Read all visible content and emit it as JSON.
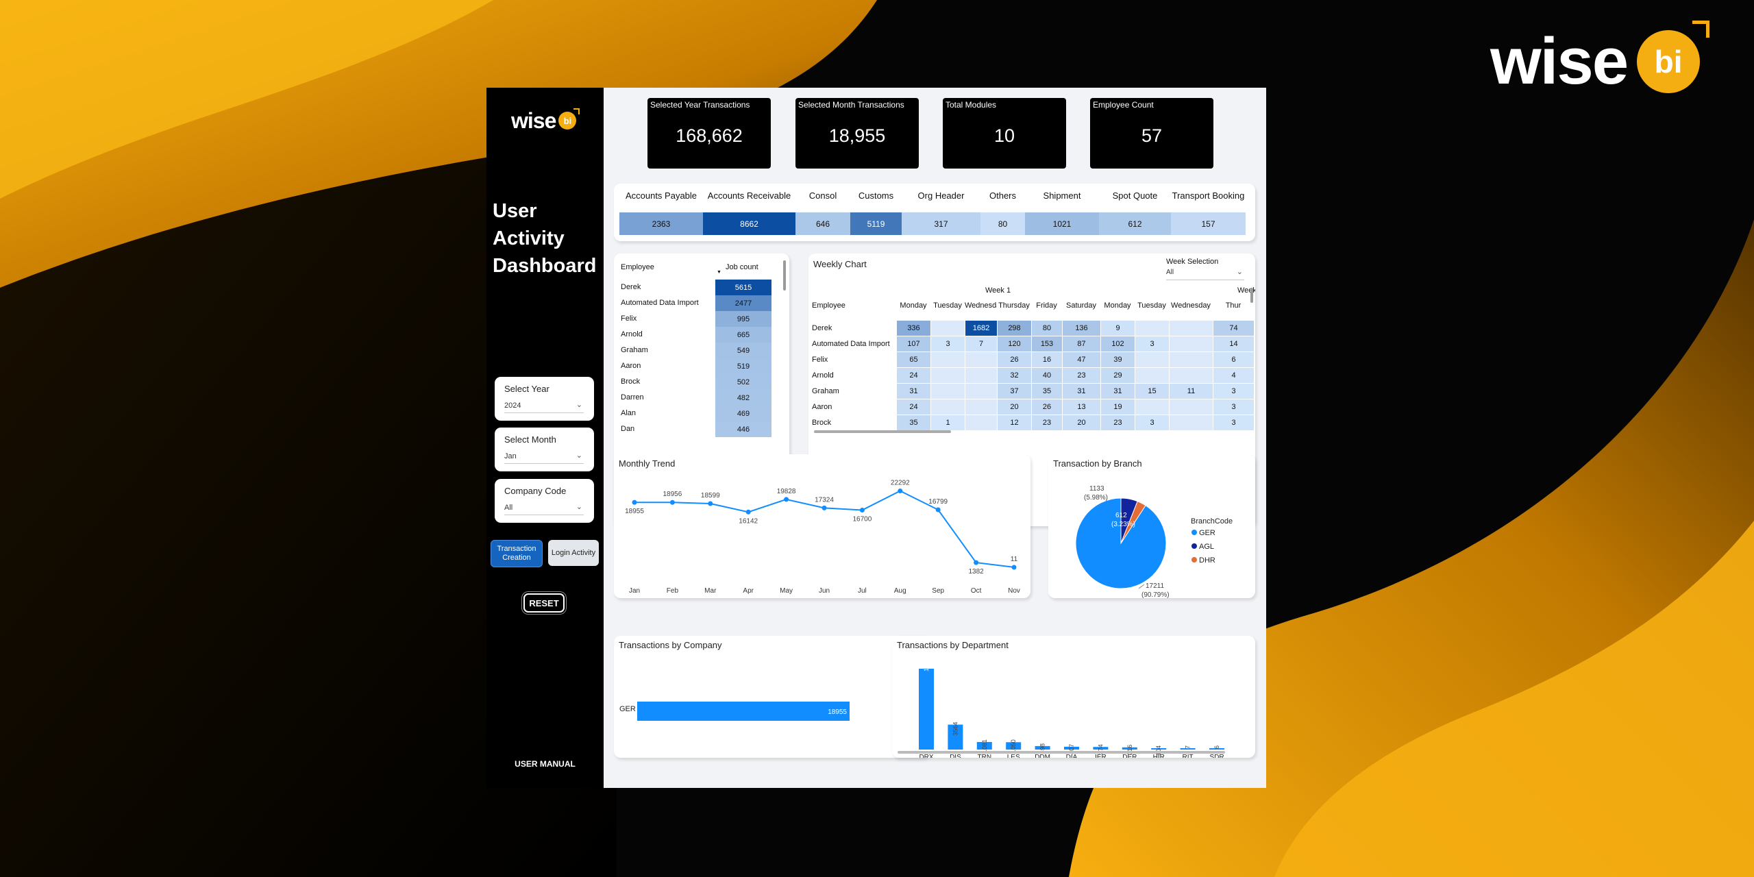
{
  "brand": {
    "text": "wise",
    "badge": "bi"
  },
  "sidebar": {
    "title_lines": [
      "User",
      "Activity",
      "Dashboard"
    ],
    "slicers": [
      {
        "label": "Select Year",
        "value": "2024"
      },
      {
        "label": "Select Month",
        "value": "Jan"
      },
      {
        "label": "Company Code",
        "value": "All"
      }
    ],
    "buttons": {
      "transaction_creation": "Transaction Creation",
      "login_activity": "Login Activity",
      "reset": "RESET"
    },
    "user_manual": "USER MANUAL"
  },
  "kpis": [
    {
      "label": "Selected Year Transactions",
      "value": "168,662"
    },
    {
      "label": "Selected Month Transactions",
      "value": "18,955"
    },
    {
      "label": "Total Modules",
      "value": "10"
    },
    {
      "label": "Employee Count",
      "value": "57"
    }
  ],
  "modules": {
    "headers": [
      "Accounts Payable",
      "Accounts Receivable",
      "Consol",
      "Customs",
      "Org Header",
      "Others",
      "Shipment",
      "Spot Quote",
      "Transport Booking"
    ],
    "values": [
      2363,
      8662,
      646,
      5119,
      317,
      80,
      1021,
      612,
      157
    ]
  },
  "employee_table": {
    "col_employee": "Employee",
    "col_job_count": "Job count",
    "rows": [
      {
        "name": "Derek",
        "count": 5615
      },
      {
        "name": "Automated Data Import",
        "count": 2477
      },
      {
        "name": "Felix",
        "count": 995
      },
      {
        "name": "Arnold",
        "count": 665
      },
      {
        "name": "Graham",
        "count": 549
      },
      {
        "name": "Aaron",
        "count": 519
      },
      {
        "name": "Brock",
        "count": 502
      },
      {
        "name": "Darren",
        "count": 482
      },
      {
        "name": "Alan",
        "count": 469
      },
      {
        "name": "Dan",
        "count": 446
      }
    ]
  },
  "weekly_chart": {
    "title": "Weekly Chart",
    "week_selection_label": "Week Selection",
    "week_selection_value": "All",
    "week1_label": "Week 1",
    "week2_label": "Week",
    "col_employee": "Employee",
    "days": [
      "Monday",
      "Tuesday",
      "Wednesday",
      "Thursday",
      "Friday",
      "Saturday",
      "Monday",
      "Tuesday",
      "Wednesday",
      "Thur"
    ],
    "rows": [
      {
        "name": "Derek",
        "values": [
          "336",
          "",
          "1682",
          "298",
          "80",
          "136",
          "9",
          "",
          "",
          "74"
        ]
      },
      {
        "name": "Automated Data Import",
        "values": [
          "107",
          "3",
          "7",
          "120",
          "153",
          "87",
          "102",
          "3",
          "",
          "14"
        ]
      },
      {
        "name": "Felix",
        "values": [
          "65",
          "",
          "",
          "26",
          "16",
          "47",
          "39",
          "",
          "",
          "6"
        ]
      },
      {
        "name": "Arnold",
        "values": [
          "24",
          "",
          "",
          "32",
          "40",
          "23",
          "29",
          "",
          "",
          "4"
        ]
      },
      {
        "name": "Graham",
        "values": [
          "31",
          "",
          "",
          "37",
          "35",
          "31",
          "31",
          "15",
          "11",
          "3"
        ]
      },
      {
        "name": "Aaron",
        "values": [
          "24",
          "",
          "",
          "20",
          "26",
          "13",
          "19",
          "",
          "",
          "3"
        ]
      },
      {
        "name": "Brock",
        "values": [
          "35",
          "1",
          "",
          "12",
          "23",
          "20",
          "23",
          "3",
          "",
          "3"
        ]
      }
    ]
  },
  "monthly_trend": {
    "title": "Monthly Trend"
  },
  "transaction_by_branch": {
    "title": "Transaction by Branch",
    "legend_title": "BranchCode"
  },
  "transactions_by_company": {
    "title": "Transactions by Company"
  },
  "transactions_by_department": {
    "title": "Transactions by Department"
  },
  "colors": {
    "accent": "#118dff",
    "dark_blue": "#0b4ea2",
    "brand_yellow": "#f5ae12"
  },
  "chart_data": [
    {
      "type": "line",
      "title": "Monthly Trend",
      "categories": [
        "Jan",
        "Feb",
        "Mar",
        "Apr",
        "May",
        "Jun",
        "Jul",
        "Aug",
        "Sep",
        "Oct",
        "Nov"
      ],
      "values": [
        18955,
        18956,
        18599,
        16142,
        19828,
        17324,
        16700,
        22292,
        16799,
        1382,
        11
      ],
      "labels": [
        "18955",
        "18956",
        "18599",
        "16142",
        "19828",
        "17324",
        "16700",
        "22292",
        "16799",
        "1382",
        "11"
      ],
      "color": "#118dff"
    },
    {
      "type": "pie",
      "title": "Transaction by Branch",
      "legend_title": "BranchCode",
      "slices": [
        {
          "name": "GER",
          "value": 17211,
          "label": "17211",
          "pct_label": "(90.79%)",
          "color": "#118dff"
        },
        {
          "name": "AGL",
          "value": 1133,
          "label": "1133",
          "pct_label": "(5.98%)",
          "color": "#12239e"
        },
        {
          "name": "DHR",
          "value": 612,
          "label": "612",
          "pct_label": "(3.23%)",
          "color": "#e66c37"
        }
      ]
    },
    {
      "type": "bar",
      "orientation": "horizontal",
      "title": "Transactions by Company",
      "categories": [
        "GER"
      ],
      "values": [
        18955
      ],
      "labels": [
        "18955"
      ],
      "color": "#118dff"
    },
    {
      "type": "bar",
      "title": "Transactions by Department",
      "categories": [
        "DRX",
        "DIS",
        "TRN",
        "LES",
        "DDM",
        "DIA",
        "IER",
        "DER",
        "HIR",
        "RIT",
        "SDR"
      ],
      "values": [
        11547,
        3564,
        1081,
        1050,
        498,
        407,
        374,
        316,
        104,
        7,
        6
      ],
      "labels": [
        "11547",
        "3564",
        "1081",
        "1050",
        "498",
        "407",
        "374",
        "316",
        "104",
        "7",
        "6"
      ],
      "color": "#118dff"
    }
  ]
}
